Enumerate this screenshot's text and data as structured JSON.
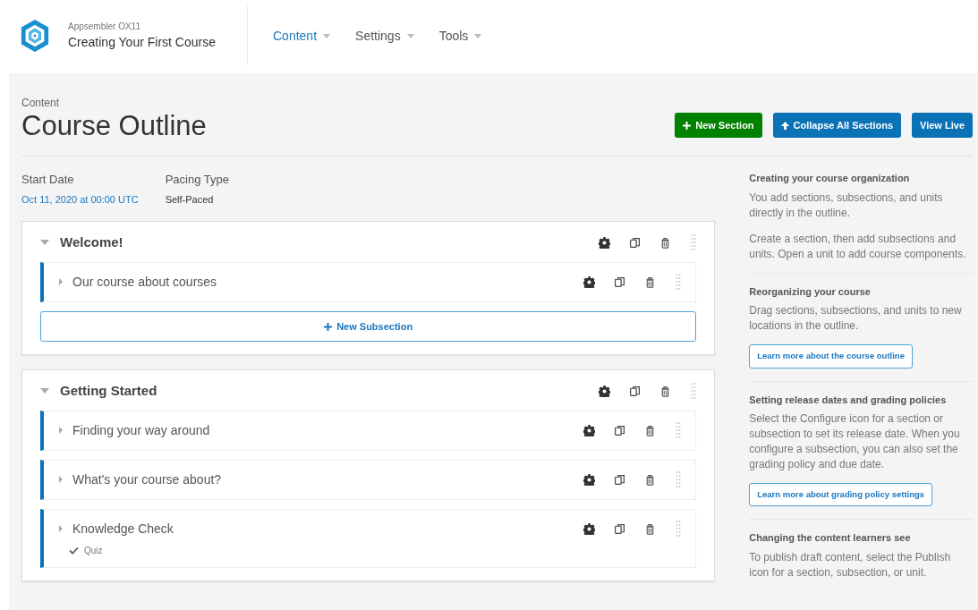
{
  "header": {
    "org": "Appsembler OX11",
    "course": "Creating Your First Course",
    "nav": [
      {
        "label": "Content",
        "selected": true
      },
      {
        "label": "Settings",
        "selected": false
      },
      {
        "label": "Tools",
        "selected": false
      }
    ]
  },
  "page": {
    "breadcrumb": "Content",
    "title": "Course Outline",
    "actions": [
      {
        "label": "New Section",
        "kind": "add"
      },
      {
        "label": "Collapse All Sections",
        "kind": "collapse"
      },
      {
        "label": "View Live",
        "kind": "view"
      }
    ]
  },
  "details": [
    {
      "label": "Start Date",
      "value": "Oct 11, 2020 at 00:00 UTC",
      "kind": "link"
    },
    {
      "label": "Pacing Type",
      "value": "Self-Paced",
      "kind": "text"
    }
  ],
  "sections": [
    {
      "title": "Welcome!",
      "expanded": true,
      "subsections": [
        {
          "title": "Our course about courses",
          "expanded": false
        }
      ],
      "add_button": "New Subsection"
    },
    {
      "title": "Getting Started",
      "expanded": true,
      "subsections": [
        {
          "title": "Finding your way around",
          "expanded": false
        },
        {
          "title": "What's your course about?",
          "expanded": false
        },
        {
          "title": "Knowledge Check",
          "expanded": false,
          "tag": "Quiz"
        }
      ]
    }
  ],
  "sidebar": [
    {
      "heading": "Creating your course organization",
      "paragraphs": [
        "You add sections, subsections, and units directly in the outline.",
        "Create a section, then add subsections and units. Open a unit to add course components."
      ]
    },
    {
      "heading": "Reorganizing your course",
      "paragraphs": [
        "Drag sections, subsections, and units to new locations in the outline."
      ],
      "link": "Learn more about the course outline"
    },
    {
      "heading": "Setting release dates and grading policies",
      "paragraphs": [
        "Select the Configure icon for a section or subsection to set its release date. When you configure a subsection, you can also set the grading policy and due date."
      ],
      "link": "Learn more about grading policy settings"
    },
    {
      "heading": "Changing the content learners see",
      "paragraphs": [
        "To publish draft content, select the Publish icon for a section, subsection, or unit."
      ]
    }
  ]
}
